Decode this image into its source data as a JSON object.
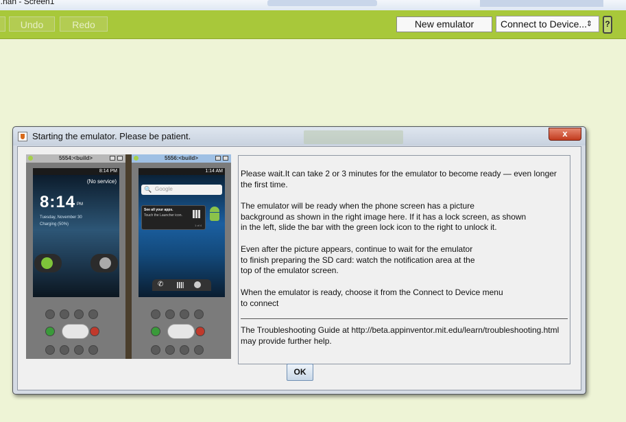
{
  "window": {
    "title_fragment": "...nan - Screen1"
  },
  "toolbar": {
    "undo_label": "Undo",
    "redo_label": "Redo",
    "new_emulator_label": "New emulator",
    "connect_label": "Connect to Device...",
    "help_label": "?"
  },
  "dialog": {
    "title": "Starting the emulator.  Please be patient.",
    "close_label": "x",
    "ok_label": "OK",
    "paragraphs": [
      "Please wait.It can take 2 or 3 minutes for the emulator to become ready — even longer\nthe first time.",
      "The emulator will be ready when the phone screen has a picture\nbackground as shown in the right image here. If it has a lock screen, as shown\nin the left, slide the bar with the green lock icon to the right to unlock it.",
      "Even after the picture appears, continue to wait for the emulator\nto finish preparing the SD card: watch the notification area at the\ntop of the emulator screen.",
      "When the emulator is ready, choose it from the Connect to Device menu\nto connect",
      "The Troubleshooting Guide at http://beta.appinventor.mit.edu/learn/troubleshooting.html\nmay provide further help."
    ],
    "left_phone": {
      "title": "5554:<build>",
      "status_time": "8:14 PM",
      "no_service": "(No service)",
      "clock": "8:14",
      "am_pm": "PM",
      "date": "Tuesday, November 30",
      "charging": "Charging (50%)"
    },
    "right_phone": {
      "title": "5556:<build>",
      "status_time": "1:14 AM",
      "search_placeholder": "Google",
      "widget_title": "See all your apps.",
      "widget_sub": "Touch the Launcher icon.",
      "widget_page": "1 of 4"
    }
  },
  "colors": {
    "toolbar": "#a8c83a",
    "background": "#eef4d6",
    "dialog_bg": "#f0f0f0",
    "android_green": "#8bc34a"
  }
}
